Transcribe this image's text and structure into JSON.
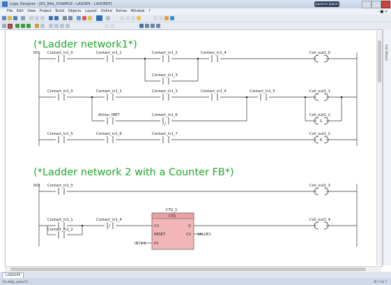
{
  "window": {
    "title": "Logic Designer - [EG_RAIL_EXAMPLE - LADDER - LADDERP]",
    "ime_label": "Japanese (Japan)"
  },
  "menu": {
    "items": [
      "File",
      "Edit",
      "View",
      "Project",
      "Build",
      "Objects",
      "Layout",
      "Online",
      "Extras",
      "Window",
      "?"
    ],
    "window_buttons": "- ■ ×"
  },
  "editor": {
    "comment1": "(*Ladder network1*)",
    "comment2": "(*Ladder network 2 with a Counter FB*)",
    "network1_number": "001",
    "network2_number": "002",
    "n1": {
      "r1c1": "Contact_in1_0",
      "r1c2": "Contact_in1_1",
      "r1c3": "Contact_in1_2",
      "r1c4": "Contact_in1_4",
      "r1coil": "Coil_out1_0",
      "r1b": "Contact_in1_3",
      "r2c1": "Contact_in1_0",
      "r2c2": "Contact_in1_2",
      "r2c3": "Contact_in1_3",
      "r2c4": "Contact_in1_4",
      "r2c5": "Contact_in1_5",
      "r2coil1": "Coil_out1_1",
      "r2coil2": "Coil_out1_2",
      "r2b1": "Action_INET",
      "r2b2": "Contact_in1_6",
      "r3c1": "Contact_in1_5",
      "r3c2": "Contact_in1_6",
      "r3c3": "Contact_in1_7",
      "r3coil": "Coil_out1_2"
    },
    "n2": {
      "r1c1": "Contact_in1_0",
      "r1coil": "Coil_out1_3",
      "r2c1": "Contact_in1_1",
      "r2c2": "Contact_in1_4",
      "r2b": "Contact_in1_2",
      "r2coil": "Coil_out1_4",
      "fb_instance": "CTU_1",
      "fb_type": "CTU",
      "pin_cu": "CU",
      "pin_reset": "RESET",
      "pin_pv": "PV",
      "pin_q": "Q",
      "pin_cv": "CV",
      "pv_value": "INT#3",
      "cv_var": "VALUE1"
    },
    "coil_marks": {
      "set": "S",
      "reset": "R"
    },
    "contact_neg": "/"
  },
  "right_panel": {
    "label": "Edit Wizard"
  },
  "tabs": {
    "active": "LADDERP"
  },
  "status": {
    "left": "For Help, press F1",
    "right": "Rt 7 Ch 7"
  },
  "colors": {
    "comment": "#1fa92c",
    "fb_fill": "#f3b6b6",
    "fb_header": "#e8a0a0"
  }
}
